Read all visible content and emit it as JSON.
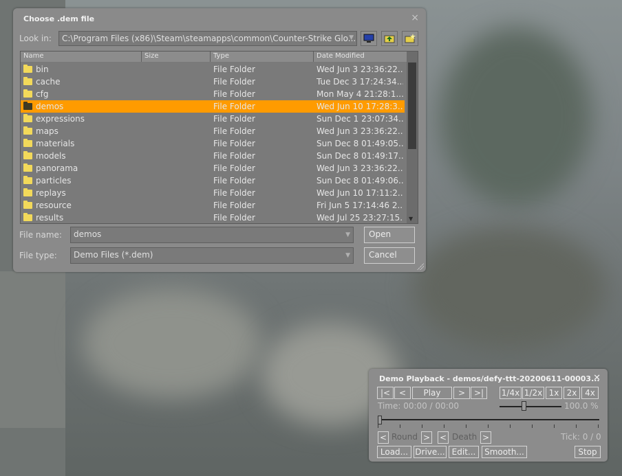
{
  "file_dialog": {
    "title": "Choose .dem file",
    "close_glyph": "×",
    "look_in_label": "Look in:",
    "look_in_value": "C:\\Program Files (x86)\\Steam\\steamapps\\common\\Counter-Strike Glo...",
    "toolbar_icons": [
      "desktop-icon",
      "folder-up-icon",
      "new-folder-icon"
    ],
    "columns": [
      "Name",
      "Size",
      "Type",
      "Date Modified"
    ],
    "rows": [
      {
        "name": "bin",
        "size": "",
        "type": "File Folder",
        "date": "Wed Jun  3 23:36:22..."
      },
      {
        "name": "cache",
        "size": "",
        "type": "File Folder",
        "date": "Tue Dec  3 17:24:34..."
      },
      {
        "name": "cfg",
        "size": "",
        "type": "File Folder",
        "date": "Mon May  4 21:28:1..."
      },
      {
        "name": "demos",
        "size": "",
        "type": "File Folder",
        "date": "Wed Jun 10 17:28:3...",
        "selected": true
      },
      {
        "name": "expressions",
        "size": "",
        "type": "File Folder",
        "date": "Sun Dec  1 23:07:34..."
      },
      {
        "name": "maps",
        "size": "",
        "type": "File Folder",
        "date": "Wed Jun  3 23:36:22..."
      },
      {
        "name": "materials",
        "size": "",
        "type": "File Folder",
        "date": "Sun Dec  8 01:49:05..."
      },
      {
        "name": "models",
        "size": "",
        "type": "File Folder",
        "date": "Sun Dec  8 01:49:17..."
      },
      {
        "name": "panorama",
        "size": "",
        "type": "File Folder",
        "date": "Wed Jun  3 23:36:22..."
      },
      {
        "name": "particles",
        "size": "",
        "type": "File Folder",
        "date": "Sun Dec  8 01:49:06..."
      },
      {
        "name": "replays",
        "size": "",
        "type": "File Folder",
        "date": "Wed Jun 10 17:11:2..."
      },
      {
        "name": "resource",
        "size": "",
        "type": "File Folder",
        "date": "Fri Jun  5 17:14:46 2..."
      },
      {
        "name": "results",
        "size": "",
        "type": "File Folder",
        "date": "Wed Jul 25 23:27:15..."
      }
    ],
    "file_name_label": "File name:",
    "file_name_value": "demos",
    "file_type_label": "File type:",
    "file_type_value": "Demo Files (*.dem)",
    "open_label": "Open",
    "cancel_label": "Cancel"
  },
  "demo_playback": {
    "title": "Demo Playback - demos/defy-ttt-20200611-00003...",
    "close_glyph": "✕",
    "transport": {
      "first": "|<",
      "prev": "<",
      "play": "Play",
      "next": ">",
      "last": ">|"
    },
    "speeds": [
      "1/4x",
      "1/2x",
      "1x",
      "2x",
      "4x"
    ],
    "time_label": "Time: 00:00 / 00:00",
    "speed_percent": "100.0 %",
    "speed_slider_fraction": 0.38,
    "progress_fraction": 0.0,
    "round_prev": "<",
    "round_label": "Round",
    "round_next": ">",
    "death_prev": "<",
    "death_label": "Death",
    "death_next": ">",
    "tick_label": "Tick: 0 / 0",
    "load_label": "Load...",
    "drive_label": "Drive...",
    "edit_label": "Edit...",
    "smooth_label": "Smooth...",
    "stop_label": "Stop"
  },
  "colors": {
    "selection": "#ff9b00",
    "panel": "#8a8a8a"
  }
}
